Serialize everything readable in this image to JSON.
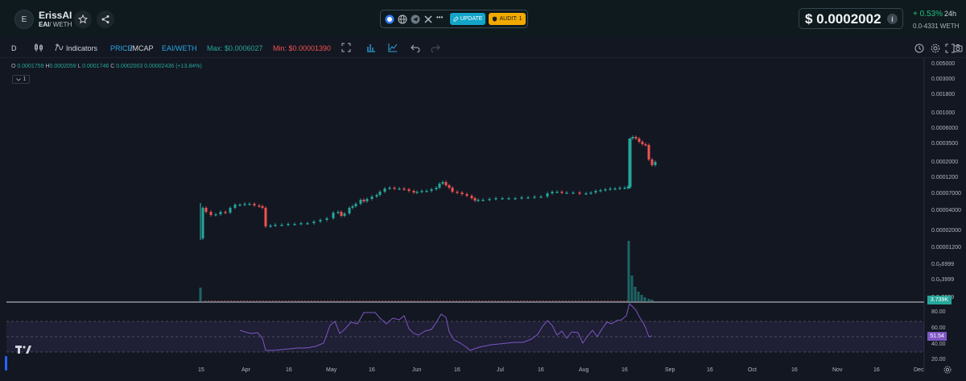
{
  "header": {
    "avatar_letter": "E",
    "token_name": "ErissAI",
    "base_symbol": "EAI",
    "quote_symbol": "/ WETH",
    "update_label": "UPDATE",
    "audit_label": "AUDIT: 1",
    "more_label": "•••",
    "price": "$ 0.0002002",
    "info_label": "i",
    "change": "+ 0.53%",
    "period": "24h",
    "liquidity": "0.0-4331  WETH"
  },
  "toolbar": {
    "interval": "D",
    "indicators_label": "Indicators",
    "price_label": "PRICE",
    "mcap_label": "/MCAP",
    "pair_label": "EAI/WETH",
    "max_label": "Max: $0.0006027",
    "min_label": "Min: $0.00001390"
  },
  "legend": {
    "o_label": "O",
    "o": "0.0001759",
    "h_label": "H",
    "h": "0.0002059",
    "l_label": "L",
    "l": "0.0001746",
    "c_label": "C",
    "c": "0.0002003",
    "change": "0.00002436 (+13.84%)",
    "collapse": "1"
  },
  "price_axis": [
    "0.005000",
    "0.003000",
    "0.001800",
    "0.001000",
    "0.0006000",
    "0.0003500",
    "0.0002000",
    "0.0001200",
    "0.00007000",
    "0.00004000",
    "0.00002000",
    "0.00001200",
    "0.0₅6999",
    "0.0₅3999",
    "0.0₅2399"
  ],
  "last_volume_tag": "3.739K",
  "rsi_axis": [
    "80.00",
    "60.00",
    "40.00",
    "20.00"
  ],
  "rsi_tag": "51.54",
  "date_axis": [
    "15",
    "Apr",
    "16",
    "May",
    "16",
    "Jun",
    "16",
    "Jul",
    "16",
    "Aug",
    "16",
    "Sep",
    "16",
    "Oct",
    "16",
    "Nov",
    "16",
    "Dec"
  ],
  "colors": {
    "up": "#26a69a",
    "down": "#ef5350",
    "rsi": "#7e57c2",
    "accent": "#12a5c8",
    "audit": "#f2a900"
  }
}
